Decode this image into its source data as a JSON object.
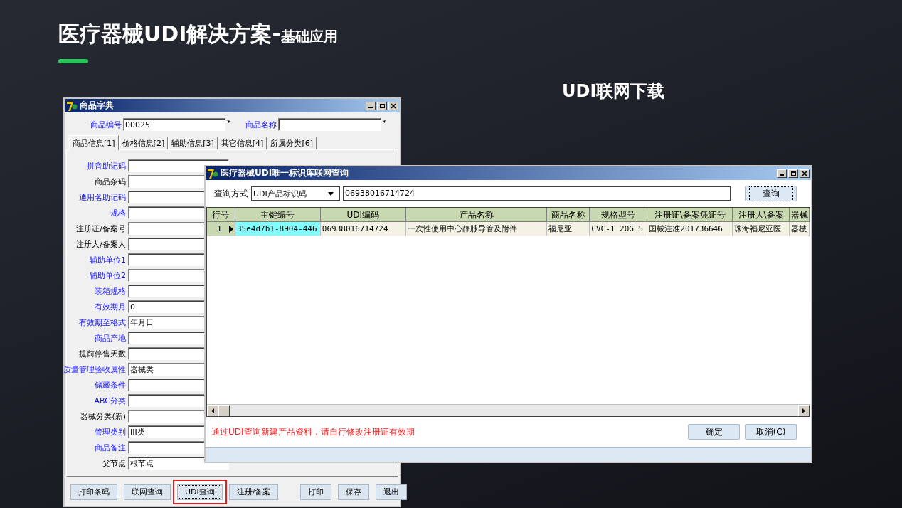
{
  "slide": {
    "title": "医疗器械UDI解决方案-",
    "subtitle": "基础应用",
    "heading": "UDI联网下载"
  },
  "product_window": {
    "title": "商品字典",
    "code_label": "商品编号",
    "code_value": "00025",
    "code_mark": "*",
    "name_label": "商品名称",
    "name_mark": "*",
    "tabs": [
      {
        "label": "商品信息[1]",
        "selected": true
      },
      {
        "label": "价格信息[2]",
        "selected": false
      },
      {
        "label": "辅助信息[3]",
        "selected": false
      },
      {
        "label": "其它信息[4]",
        "selected": false
      },
      {
        "label": "所属分类[6]",
        "selected": false
      }
    ],
    "fields": [
      {
        "label": "拼音助记码",
        "highlighted": true
      },
      {
        "label": "商品条码",
        "highlighted": false
      },
      {
        "label": "通用名助记码",
        "highlighted": true
      },
      {
        "label": "规格",
        "highlighted": true
      },
      {
        "label": "注册证/备案号",
        "highlighted": false
      },
      {
        "label": "注册人/备案人",
        "highlighted": false
      },
      {
        "label": "辅助单位1",
        "highlighted": true
      },
      {
        "label": "辅助单位2",
        "highlighted": true
      },
      {
        "label": "装箱规格",
        "highlighted": true
      },
      {
        "label": "有效期月",
        "value": "0",
        "highlighted": true
      },
      {
        "label": "有效期至格式",
        "value": "年月日",
        "highlighted": true
      },
      {
        "label": "商品产地",
        "highlighted": true
      },
      {
        "label": "提前停售天数",
        "highlighted": false
      },
      {
        "label": "质量管理验收属性",
        "value": "器械类",
        "highlighted": true
      },
      {
        "label": "储藏条件",
        "highlighted": true
      },
      {
        "label": "ABC分类",
        "highlighted": true
      },
      {
        "label": "器械分类(新)",
        "highlighted": false
      },
      {
        "label": "管理类别",
        "value": "III类",
        "highlighted": true
      },
      {
        "label": "商品备注",
        "highlighted": true
      },
      {
        "label": "父节点",
        "value": "根节点",
        "highlighted": false
      }
    ],
    "buttons": [
      {
        "label": "打印条码",
        "highlighted": false
      },
      {
        "label": "联网查询",
        "highlighted": false
      },
      {
        "label": "UDI查询",
        "highlighted": true
      },
      {
        "label": "注册/备案",
        "highlighted": false
      },
      {
        "label": "打印",
        "highlighted": false
      },
      {
        "label": "保存",
        "highlighted": false
      },
      {
        "label": "退出",
        "highlighted": false
      }
    ]
  },
  "udi_dialog": {
    "title": "医疗器械UDI唯一标识库联网查询",
    "query_label": "查询方式",
    "query_mode": "UDI产品标识码",
    "query_value": "06938016714724",
    "query_button": "查询",
    "table": {
      "columns": [
        "行号",
        "主键编号",
        "UDI编码",
        "产品名称",
        "商品名称",
        "规格型号",
        "注册证\\备案凭证号",
        "注册人\\备案",
        "器械"
      ],
      "rows": [
        {
          "selected": true,
          "cells": [
            {
              "text": "1",
              "focused": false
            },
            {
              "text": "35e4d7b1-8904-446",
              "focused": true
            },
            {
              "text": "06938016714724",
              "focused": false
            },
            {
              "text": "一次性使用中心静脉导管及附件",
              "focused": false
            },
            {
              "text": "福尼亚",
              "focused": false
            },
            {
              "text": "CVC-1 20G 5",
              "focused": false
            },
            {
              "text": "国械注准201736646",
              "focused": false
            },
            {
              "text": "珠海福尼亚医",
              "focused": false
            },
            {
              "text": "器械",
              "focused": false
            }
          ]
        }
      ]
    },
    "message": "通过UDI查询新建产品资料，请自行修改注册证有效期",
    "buttons": [
      "确定",
      "取消(C)"
    ]
  }
}
